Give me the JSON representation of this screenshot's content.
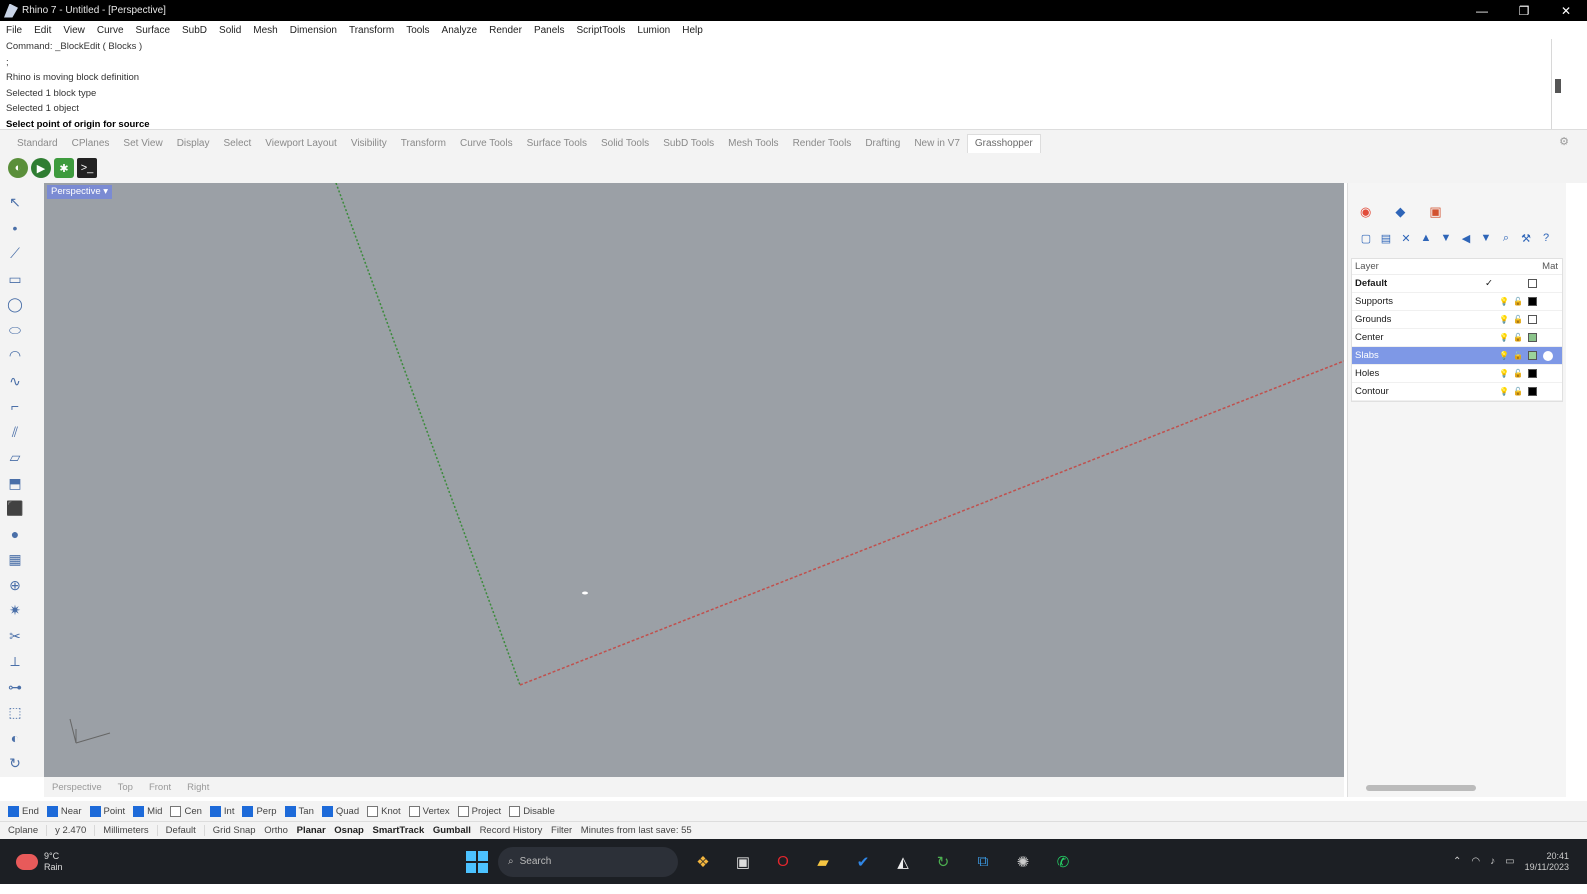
{
  "window": {
    "title": "Rhino 7 - Untitled - [Perspective]",
    "controls": [
      "—",
      "❐",
      "✕"
    ]
  },
  "menu": [
    "File",
    "Edit",
    "View",
    "Curve",
    "Surface",
    "SubD",
    "Solid",
    "Mesh",
    "Dimension",
    "Transform",
    "Tools",
    "Analyze",
    "Render",
    "Panels",
    "ScriptTools",
    "Lumion",
    "Help"
  ],
  "command_history": [
    "Command: _BlockEdit ( Blocks )",
    ";",
    "Rhino is moving block definition",
    "Selected 1 block type",
    "Selected 1 object",
    "Select point of origin for source"
  ],
  "toolbar_tabs": [
    "Standard",
    "CPlanes",
    "Set View",
    "Display",
    "Select",
    "Viewport Layout",
    "Visibility",
    "Transform",
    "Curve Tools",
    "Surface Tools",
    "Solid Tools",
    "SubD Tools",
    "Mesh Tools",
    "Render Tools",
    "Drafting",
    "New in V7",
    "Grasshopper"
  ],
  "active_tab": "Grasshopper",
  "viewport": {
    "name": "Perspective",
    "dropdown_glyph": "▾"
  },
  "viewport_tabs": [
    "Perspective",
    "Top",
    "Front",
    "Right"
  ],
  "panel": {
    "tabs": [
      "color-wheel-icon",
      "layers-icon",
      "properties-icon"
    ],
    "header": {
      "layer": "Layer",
      "material": "Mat"
    },
    "layers": [
      {
        "name": "Default",
        "current": true,
        "check": "✓",
        "color": "#ffffff"
      },
      {
        "name": "Supports",
        "color": "#000000"
      },
      {
        "name": "Grounds",
        "color": "#ffffff"
      },
      {
        "name": "Center",
        "color": "#8bc48b"
      },
      {
        "name": "Slabs",
        "selected": true,
        "color": "#9bd49b"
      },
      {
        "name": "Holes",
        "color": "#000000"
      },
      {
        "name": "Contour",
        "color": "#000000"
      }
    ]
  },
  "osnaps": [
    {
      "label": "End",
      "on": true
    },
    {
      "label": "Near",
      "on": true
    },
    {
      "label": "Point",
      "on": true
    },
    {
      "label": "Mid",
      "on": true
    },
    {
      "label": "Cen",
      "on": false
    },
    {
      "label": "Int",
      "on": true
    },
    {
      "label": "Perp",
      "on": true
    },
    {
      "label": "Tan",
      "on": true
    },
    {
      "label": "Quad",
      "on": true
    },
    {
      "label": "Knot",
      "on": false
    },
    {
      "label": "Vertex",
      "on": false
    },
    {
      "label": "Project",
      "on": false
    },
    {
      "label": "Disable",
      "on": false
    }
  ],
  "status": {
    "cplane": "Cplane",
    "coords": "y 2.470",
    "units": "Millimeters",
    "layer": "Default",
    "grid_snap": "Grid Snap",
    "ortho": "Ortho",
    "planar": "Planar",
    "osnap": "Osnap",
    "smarttrack": "SmartTrack",
    "gumball": "Gumball",
    "record_history": "Record History",
    "filter": "Filter",
    "message": "Minutes from last save: 55"
  },
  "taskbar": {
    "weather": {
      "temp": "9°C",
      "desc": "Rain"
    },
    "search_placeholder": "Search",
    "clock": {
      "time": "20:41",
      "date": "19/11/2023"
    }
  },
  "colors": {
    "viewport_bg": "#9ba0a6",
    "x_axis": "#c0504d",
    "y_axis": "#3a8a3a",
    "accent": "#1d6ad9"
  }
}
